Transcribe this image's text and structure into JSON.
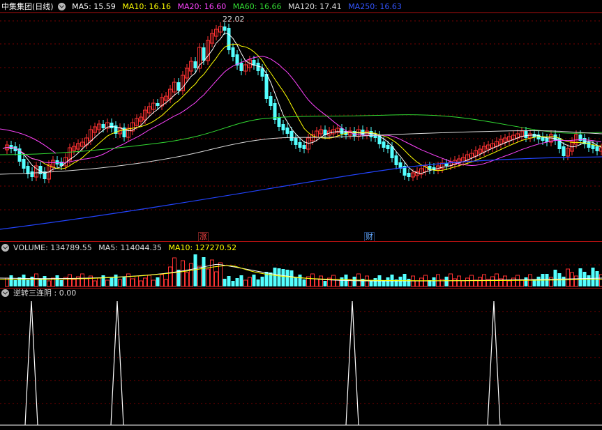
{
  "header": {
    "title": "中集集团(日线)",
    "ma": [
      {
        "label": "MA5: 15.59",
        "color": "#ffffff"
      },
      {
        "label": "MA10: 16.16",
        "color": "#ffff00"
      },
      {
        "label": "MA20: 16.60",
        "color": "#ff44ff"
      },
      {
        "label": "MA60: 16.66",
        "color": "#33dd33"
      },
      {
        "label": "MA120: 17.41",
        "color": "#dddddd"
      },
      {
        "label": "MA250: 16.63",
        "color": "#3355ff"
      }
    ]
  },
  "price_panel": {
    "high_label": "22.02",
    "markers": [
      {
        "text": "涨",
        "color": "#ff4444"
      },
      {
        "text": "财",
        "color": "#66aaff"
      }
    ]
  },
  "volume_panel": {
    "labels": [
      {
        "label": "VOLUME: 134789.55",
        "color": "#dddddd"
      },
      {
        "label": "MA5: 114044.35",
        "color": "#dddddd"
      },
      {
        "label": "MA10: 127270.52",
        "color": "#ffff00"
      }
    ]
  },
  "indicator_panel": {
    "label": "逆转三连阴 : 0.00"
  },
  "colors": {
    "up": "#ff3232",
    "down": "#54ffff",
    "grid": "#7a0000",
    "border": "#b01010"
  }
}
